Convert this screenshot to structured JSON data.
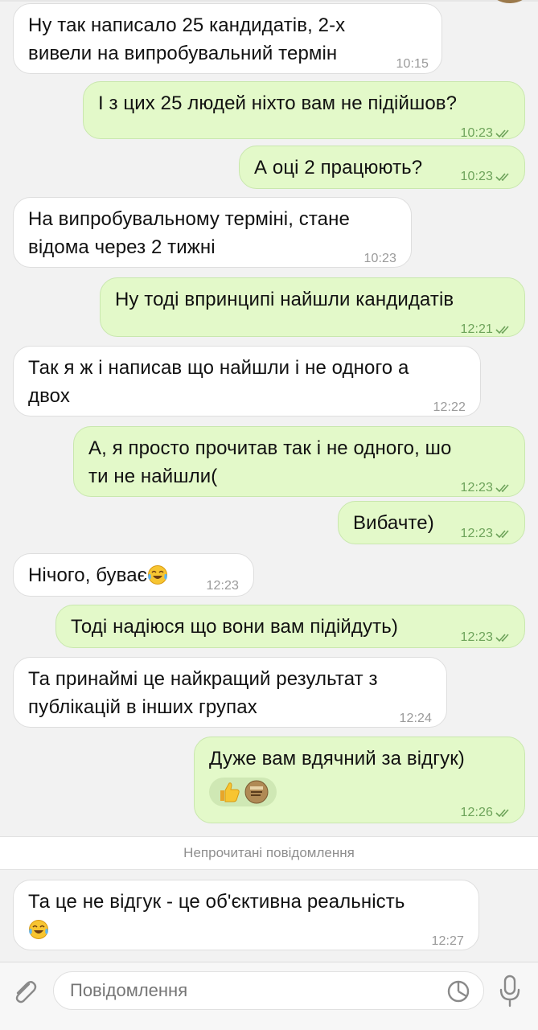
{
  "messages": [
    {
      "dir": "in",
      "lines": [
        "Ну так написало 25 кандидатів, 2-х",
        "вивели на випробувальний термін"
      ],
      "time": "10:15"
    },
    {
      "dir": "out",
      "lines": [
        "І з цих 25 людей ніхто вам не підійшов?"
      ],
      "time": "10:23"
    },
    {
      "dir": "out",
      "lines": [
        "А оці 2 працюють?"
      ],
      "time": "10:23"
    },
    {
      "dir": "in",
      "lines": [
        "На випробувальному терміні, стане",
        "відома через 2 тижні"
      ],
      "time": "10:23"
    },
    {
      "dir": "out",
      "lines": [
        "Ну тоді впринципі найшли кандидатів"
      ],
      "time": "12:21"
    },
    {
      "dir": "in",
      "lines": [
        "Так я ж і написав що найшли і не одного а",
        "двох"
      ],
      "time": "12:22"
    },
    {
      "dir": "out",
      "lines": [
        "А, я просто прочитав так і не одного, шо",
        "ти не найшли("
      ],
      "time": "12:23"
    },
    {
      "dir": "out",
      "lines": [
        "Вибачте)"
      ],
      "time": "12:23"
    },
    {
      "dir": "in",
      "lines": [
        "Нічого, буває"
      ],
      "emoji": "tears-of-joy-emoji",
      "time": "12:23"
    },
    {
      "dir": "out",
      "lines": [
        "Тоді надіюся що вони вам підійдуть)"
      ],
      "time": "12:23"
    },
    {
      "dir": "in",
      "lines": [
        "Та принаймі це найкращий результат з",
        "публікацій в інших групах"
      ],
      "time": "12:24"
    },
    {
      "dir": "out",
      "lines": [
        "Дуже вам вдячний за відгук)"
      ],
      "time": "12:26",
      "reactions": [
        "thumbs-up-emoji",
        "sticker-avatar"
      ]
    },
    {
      "dir": "in",
      "lines": [
        "Та це не відгук - це об'єктивна реальність"
      ],
      "emoji_line": "tears-of-joy-emoji",
      "time": "12:27"
    }
  ],
  "unread_divider": "Непрочитані повідомлення",
  "composer": {
    "placeholder": "Повідомлення"
  },
  "colors": {
    "incoming": "#ffffff",
    "outgoing": "#e3f9c9",
    "accent": "#6da35a",
    "background": "#f2f2f2"
  }
}
